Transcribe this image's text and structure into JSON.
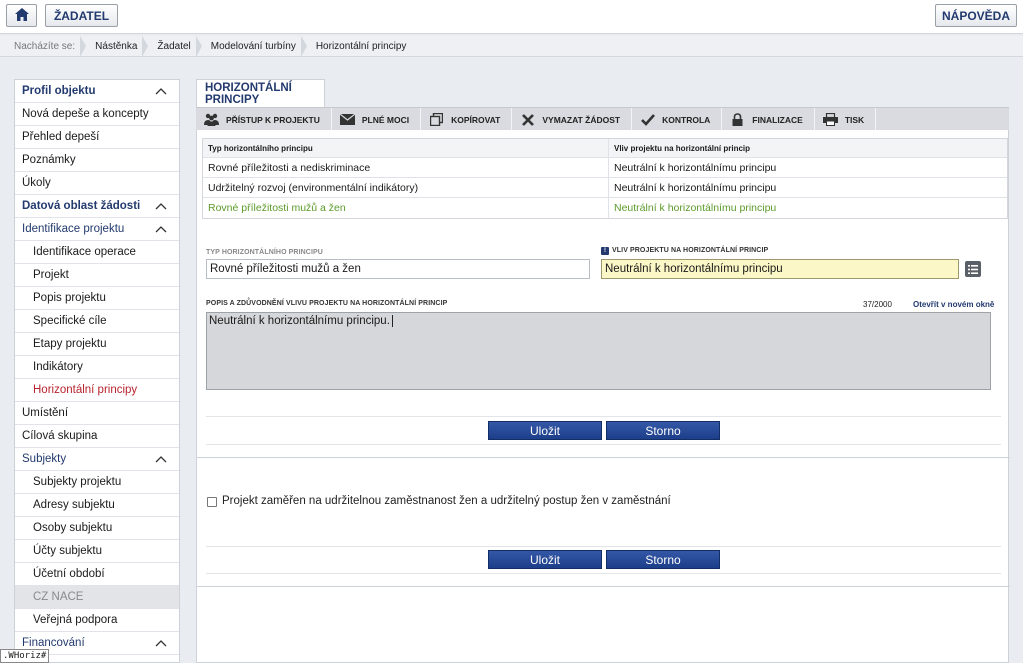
{
  "topbar": {
    "home_icon": "home-icon",
    "zadatel_label": "ŽADATEL",
    "help_label": "NÁPOVĚDA"
  },
  "breadcrumb": [
    "Nacházíte se:",
    "Nástěnka",
    "Žadatel",
    "Modelování turbíny",
    "Horizontální principy"
  ],
  "nav": [
    {
      "label": "Profil objektu",
      "type": "section",
      "chevron": true
    },
    {
      "label": "Nová depeše a koncepty",
      "type": "item"
    },
    {
      "label": "Přehled depeší",
      "type": "item"
    },
    {
      "label": "Poznámky",
      "type": "item"
    },
    {
      "label": "Úkoly",
      "type": "item"
    },
    {
      "label": "Datová oblast žádosti",
      "type": "section",
      "chevron": true
    },
    {
      "label": "Identifikace projektu",
      "type": "subhead",
      "chevron": true
    },
    {
      "label": "Identifikace operace",
      "type": "sub"
    },
    {
      "label": "Projekt",
      "type": "sub"
    },
    {
      "label": "Popis projektu",
      "type": "sub"
    },
    {
      "label": "Specifické cíle",
      "type": "sub"
    },
    {
      "label": "Etapy projektu",
      "type": "sub"
    },
    {
      "label": "Indikátory",
      "type": "sub"
    },
    {
      "label": "Horizontální principy",
      "type": "sub-active"
    },
    {
      "label": "Umístění",
      "type": "item"
    },
    {
      "label": "Cílová skupina",
      "type": "item"
    },
    {
      "label": "Subjekty",
      "type": "subhead",
      "chevron": true
    },
    {
      "label": "Subjekty projektu",
      "type": "sub"
    },
    {
      "label": "Adresy subjektu",
      "type": "sub"
    },
    {
      "label": "Osoby subjektu",
      "type": "sub"
    },
    {
      "label": "Účty subjektu",
      "type": "sub"
    },
    {
      "label": "Účetní období",
      "type": "sub"
    },
    {
      "label": "CZ NACE",
      "type": "sub-disabled"
    },
    {
      "label": "Veřejná podpora",
      "type": "sub"
    },
    {
      "label": "Financování",
      "type": "subhead",
      "chevron": true
    }
  ],
  "page": {
    "tab_label": "HORIZONTÁLNÍ PRINCIPY"
  },
  "toolbar": [
    {
      "label": "PŘÍSTUP K PROJEKTU",
      "icon": "people-icon"
    },
    {
      "label": "PLNÉ MOCI",
      "icon": "envelope-icon"
    },
    {
      "label": "KOPÍROVAT",
      "icon": "copy-icon"
    },
    {
      "label": "VYMAZAT ŽÁDOST",
      "icon": "delete-icon"
    },
    {
      "label": "KONTROLA",
      "icon": "check-icon"
    },
    {
      "label": "FINALIZACE",
      "icon": "lock-icon"
    },
    {
      "label": "TISK",
      "icon": "printer-icon"
    }
  ],
  "table": {
    "headers": [
      "Typ horizontálního principu",
      "Vliv projektu na horizontální princip"
    ],
    "rows": [
      [
        "Rovné příležitosti a nediskriminace",
        "Neutrální k horizontálnímu principu"
      ],
      [
        "Udržitelný rozvoj (environmentální indikátory)",
        "Neutrální k horizontálnímu principu"
      ],
      [
        "Rovné příležitosti mužů a žen",
        "Neutrální k horizontálnímu principu"
      ]
    ],
    "selected_row": 2
  },
  "form": {
    "type_label": "TYP HORIZONTÁLNÍHO PRINCIPU",
    "type_value": "Rovné příležitosti mužů a žen",
    "impact_label": "VLIV PROJEKTU NA HORIZONTÁLNÍ PRINCIP",
    "impact_value": "Neutrální k horizontálnímu principu",
    "desc_label": "POPIS A ZDŮVODNĚNÍ VLIVU PROJEKTU NA HORIZONTÁLNÍ PRINCIP",
    "counter": "37/2000",
    "open_link": "Otevřít v novém okně",
    "desc_value": "Neutrální k horizontálnímu principu.",
    "save_label": "Uložit",
    "cancel_label": "Storno"
  },
  "section2": {
    "checkbox_label": "Projekt zaměřen na udržitelnou zaměstnanost žen a udržitelný postup žen v zaměstnání",
    "checked": false,
    "save_label": "Uložit",
    "cancel_label": "Storno"
  },
  "status_tip": ".WHoriz#"
}
